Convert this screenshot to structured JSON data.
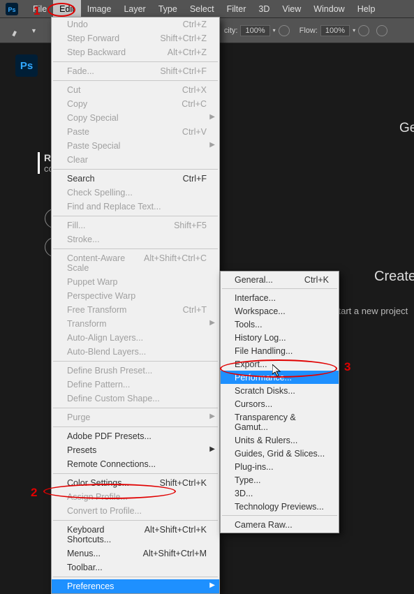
{
  "menubar": {
    "items": [
      "File",
      "Edit",
      "Image",
      "Layer",
      "Type",
      "Select",
      "Filter",
      "3D",
      "View",
      "Window",
      "Help"
    ],
    "active_index": 1
  },
  "toolbar": {
    "opacity_label": "city:",
    "opacity_value": "100%",
    "flow_label": "Flow:",
    "flow_value": "100%"
  },
  "start_screen": {
    "logo": "Ps",
    "recent_line1": "RE",
    "recent_line2": "co",
    "right_fragment_1": "Ge",
    "create_title": "Create",
    "start_text": "start a new project"
  },
  "edit_menu": [
    {
      "label": "Undo",
      "shortcut": "Ctrl+Z",
      "disabled": true
    },
    {
      "label": "Step Forward",
      "shortcut": "Shift+Ctrl+Z",
      "disabled": true
    },
    {
      "label": "Step Backward",
      "shortcut": "Alt+Ctrl+Z",
      "disabled": true
    },
    {
      "sep": true
    },
    {
      "label": "Fade...",
      "shortcut": "Shift+Ctrl+F",
      "disabled": true
    },
    {
      "sep": true
    },
    {
      "label": "Cut",
      "shortcut": "Ctrl+X",
      "disabled": true
    },
    {
      "label": "Copy",
      "shortcut": "Ctrl+C",
      "disabled": true
    },
    {
      "label": "Copy Special",
      "submenu": true,
      "disabled": true
    },
    {
      "label": "Paste",
      "shortcut": "Ctrl+V",
      "disabled": true
    },
    {
      "label": "Paste Special",
      "submenu": true,
      "disabled": true
    },
    {
      "label": "Clear",
      "disabled": true
    },
    {
      "sep": true
    },
    {
      "label": "Search",
      "shortcut": "Ctrl+F"
    },
    {
      "label": "Check Spelling...",
      "disabled": true
    },
    {
      "label": "Find and Replace Text...",
      "disabled": true
    },
    {
      "sep": true
    },
    {
      "label": "Fill...",
      "shortcut": "Shift+F5",
      "disabled": true
    },
    {
      "label": "Stroke...",
      "disabled": true
    },
    {
      "sep": true
    },
    {
      "label": "Content-Aware Scale",
      "shortcut": "Alt+Shift+Ctrl+C",
      "disabled": true
    },
    {
      "label": "Puppet Warp",
      "disabled": true
    },
    {
      "label": "Perspective Warp",
      "disabled": true
    },
    {
      "label": "Free Transform",
      "shortcut": "Ctrl+T",
      "disabled": true
    },
    {
      "label": "Transform",
      "submenu": true,
      "disabled": true
    },
    {
      "label": "Auto-Align Layers...",
      "disabled": true
    },
    {
      "label": "Auto-Blend Layers...",
      "disabled": true
    },
    {
      "sep": true
    },
    {
      "label": "Define Brush Preset...",
      "disabled": true
    },
    {
      "label": "Define Pattern...",
      "disabled": true
    },
    {
      "label": "Define Custom Shape...",
      "disabled": true
    },
    {
      "sep": true
    },
    {
      "label": "Purge",
      "submenu": true,
      "disabled": true
    },
    {
      "sep": true
    },
    {
      "label": "Adobe PDF Presets..."
    },
    {
      "label": "Presets",
      "submenu": true
    },
    {
      "label": "Remote Connections..."
    },
    {
      "sep": true
    },
    {
      "label": "Color Settings...",
      "shortcut": "Shift+Ctrl+K"
    },
    {
      "label": "Assign Profile...",
      "disabled": true
    },
    {
      "label": "Convert to Profile...",
      "disabled": true
    },
    {
      "sep": true
    },
    {
      "label": "Keyboard Shortcuts...",
      "shortcut": "Alt+Shift+Ctrl+K"
    },
    {
      "label": "Menus...",
      "shortcut": "Alt+Shift+Ctrl+M"
    },
    {
      "label": "Toolbar..."
    },
    {
      "sep": true
    },
    {
      "label": "Preferences",
      "submenu": true,
      "highlight": true
    }
  ],
  "prefs_submenu": [
    {
      "label": "General...",
      "shortcut": "Ctrl+K"
    },
    {
      "sep": true
    },
    {
      "label": "Interface..."
    },
    {
      "label": "Workspace..."
    },
    {
      "label": "Tools..."
    },
    {
      "label": "History Log..."
    },
    {
      "label": "File Handling..."
    },
    {
      "label": "Export..."
    },
    {
      "label": "Performance...",
      "highlight": true
    },
    {
      "label": "Scratch Disks..."
    },
    {
      "label": "Cursors..."
    },
    {
      "label": "Transparency & Gamut..."
    },
    {
      "label": "Units & Rulers..."
    },
    {
      "label": "Guides, Grid & Slices..."
    },
    {
      "label": "Plug-ins..."
    },
    {
      "label": "Type..."
    },
    {
      "label": "3D..."
    },
    {
      "label": "Technology Previews..."
    },
    {
      "sep": true
    },
    {
      "label": "Camera Raw..."
    }
  ],
  "annotations": {
    "num1": "1",
    "num2": "2",
    "num3": "3"
  }
}
